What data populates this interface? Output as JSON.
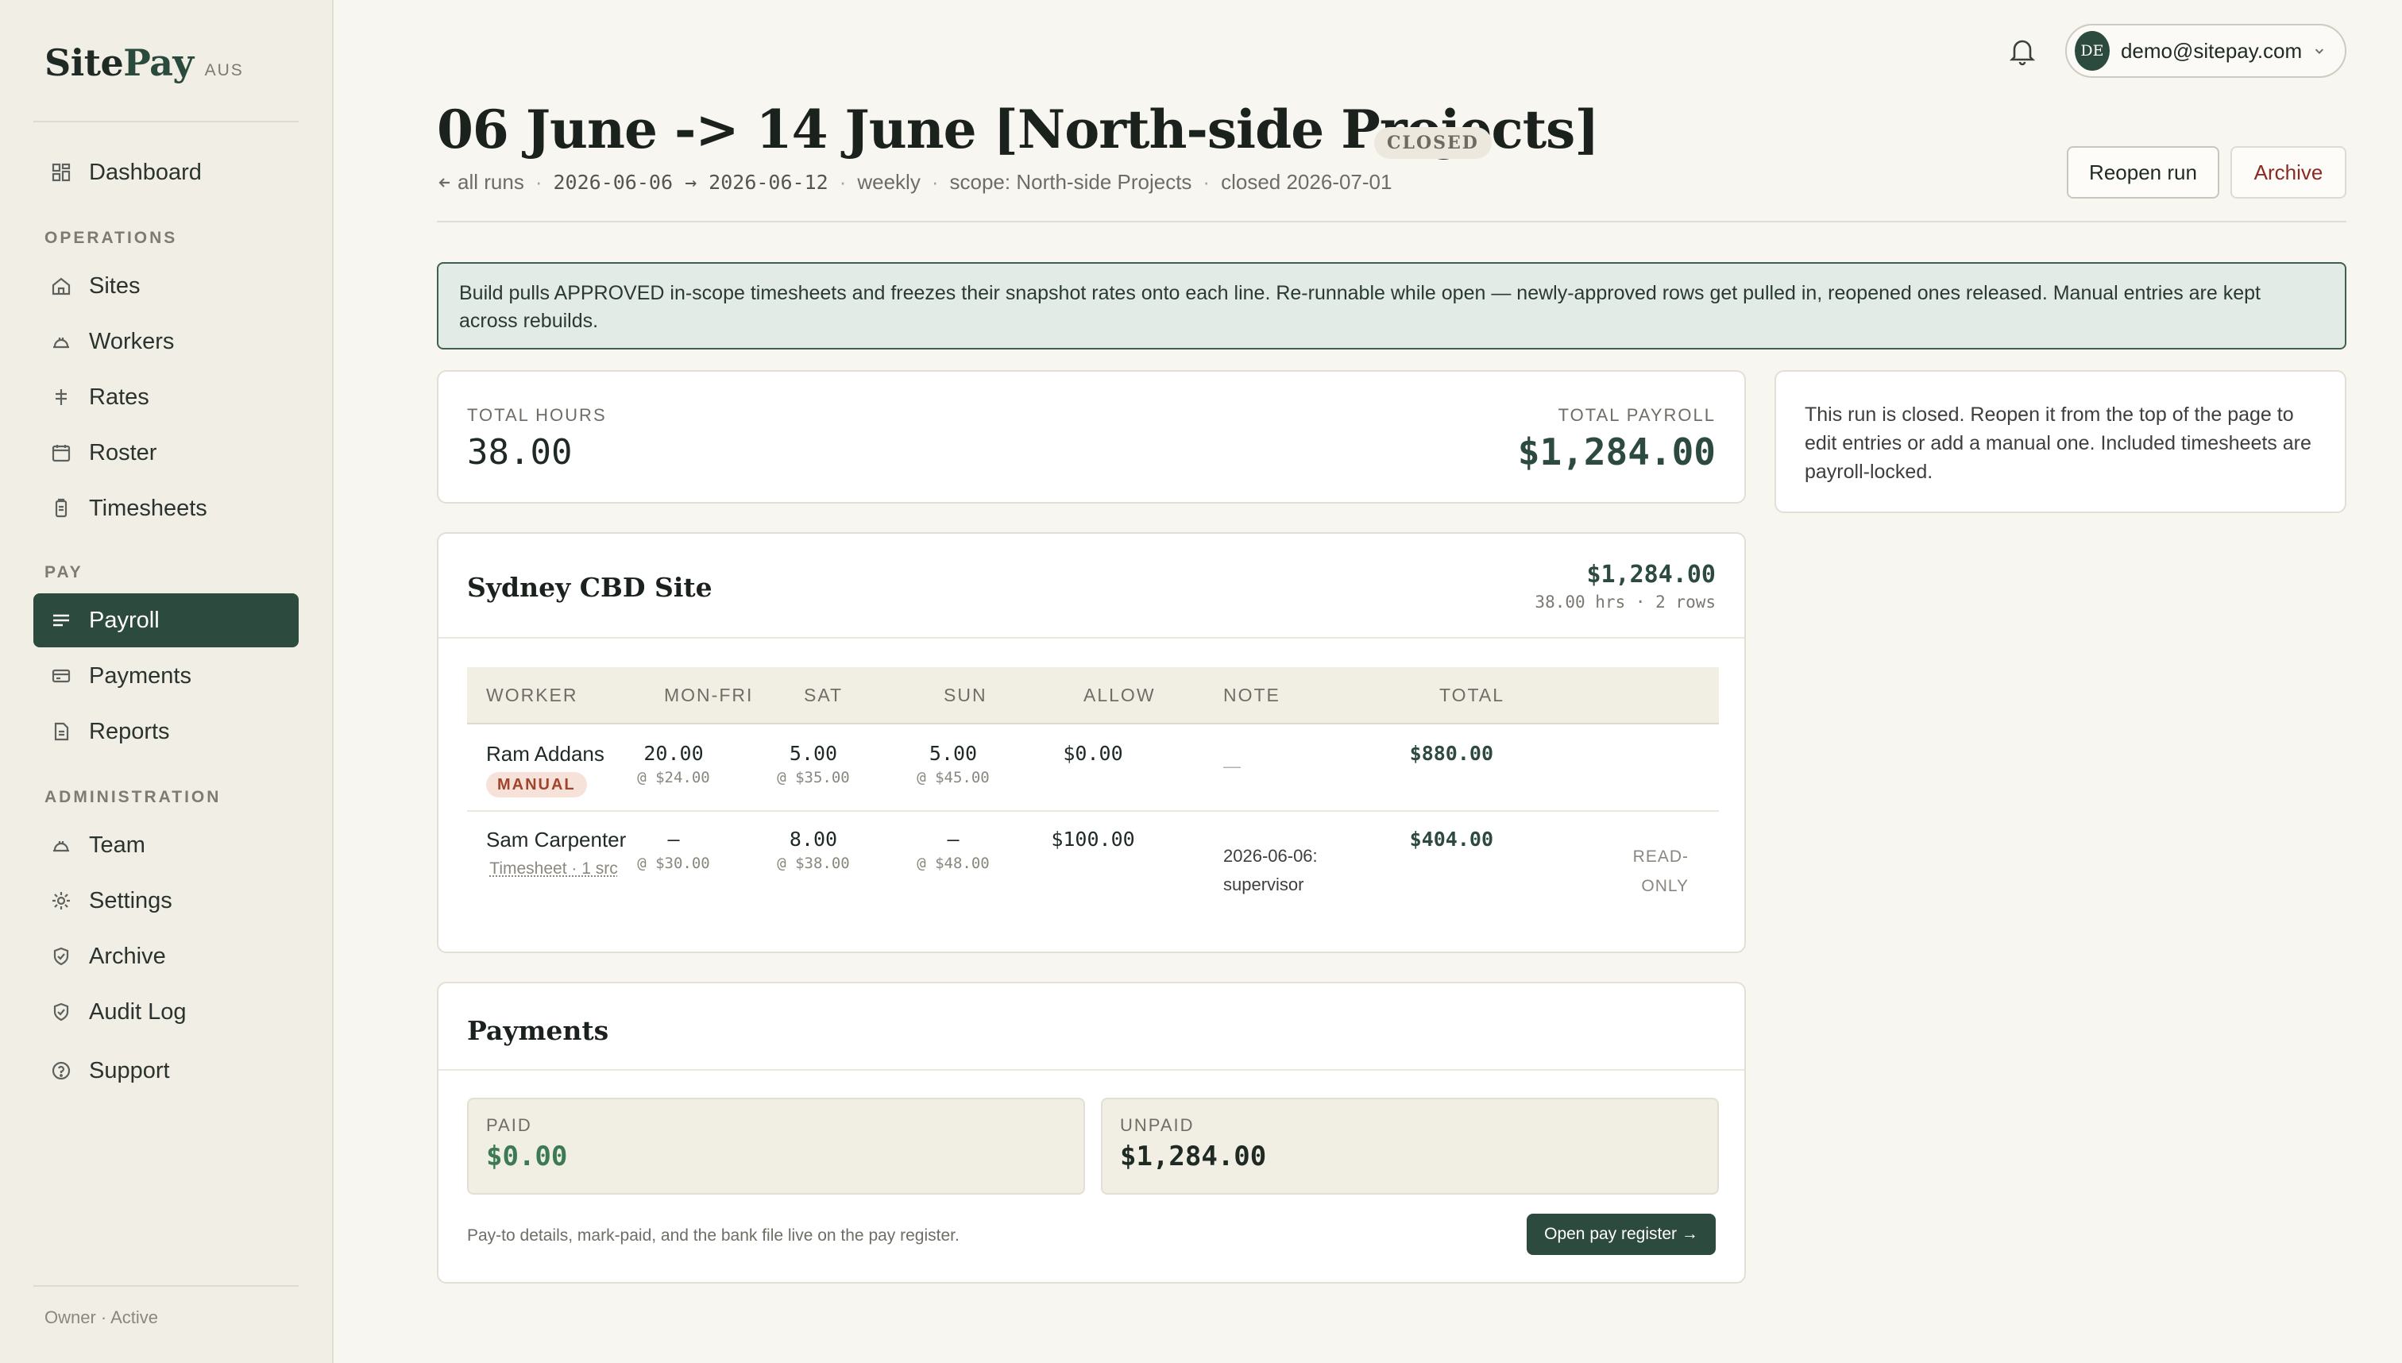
{
  "brand": {
    "name_a": "Site",
    "name_b": "Pay",
    "region": "AUS"
  },
  "sidebar": {
    "items": [
      {
        "label": "Dashboard",
        "icon": "dashboard-icon"
      },
      {
        "label": "Sites",
        "icon": "home-icon"
      },
      {
        "label": "Workers",
        "icon": "hard-hat-icon"
      },
      {
        "label": "Rates",
        "icon": "dollar-icon"
      },
      {
        "label": "Roster",
        "icon": "calendar-icon"
      },
      {
        "label": "Timesheets",
        "icon": "clipboard-icon"
      },
      {
        "label": "Payroll",
        "icon": "payroll-icon",
        "active": true
      },
      {
        "label": "Payments",
        "icon": "card-icon"
      },
      {
        "label": "Reports",
        "icon": "report-icon"
      },
      {
        "label": "Team",
        "icon": "hard-hat-icon"
      },
      {
        "label": "Settings",
        "icon": "gear-icon"
      },
      {
        "label": "Archive",
        "icon": "shield-icon"
      },
      {
        "label": "Audit Log",
        "icon": "shield-icon"
      },
      {
        "label": "Support",
        "icon": "help-icon"
      }
    ],
    "sections": {
      "operations": "OPERATIONS",
      "pay": "PAY",
      "administration": "ADMINISTRATION"
    },
    "footer": "Owner · Active"
  },
  "account": {
    "initials": "DE",
    "email": "demo@sitepay.com"
  },
  "header": {
    "title": "06 June -> 14 June [North-side Projects]",
    "status": "CLOSED",
    "back_link": "all runs",
    "dates": "2026-06-06 → 2026-06-12",
    "frequency": "weekly",
    "scope": "scope: North-side Projects",
    "closed": "closed 2026-07-01",
    "reopen_label": "Reopen run",
    "archive_label": "Archive"
  },
  "banner": "Build pulls APPROVED in-scope timesheets and freezes their snapshot rates onto each line. Re-runnable while open — newly-approved rows get pulled in, reopened ones released. Manual entries are kept across rebuilds.",
  "totals": {
    "hours_label": "TOTAL HOURS",
    "hours": "38.00",
    "payroll_label": "TOTAL PAYROLL",
    "payroll": "$1,284.00"
  },
  "side_note": "This run is closed. Reopen it from the top of the page to edit entries or add a manual one. Included timesheets are payroll-locked.",
  "site": {
    "name": "Sydney CBD Site",
    "amount": "$1,284.00",
    "summary": "38.00 hrs · 2 rows",
    "columns": [
      "WORKER",
      "MON-FRI",
      "SAT",
      "SUN",
      "ALLOW",
      "NOTE",
      "TOTAL"
    ],
    "rows": [
      {
        "worker": "Ram Addans",
        "tag": "MANUAL",
        "monfri": "20.00",
        "monfri_rate": "@ $24.00",
        "sat": "5.00",
        "sat_rate": "@ $35.00",
        "sun": "5.00",
        "sun_rate": "@ $45.00",
        "allow": "$0.00",
        "note": "—",
        "total": "$880.00"
      },
      {
        "worker": "Sam Carpenter",
        "source": "Timesheet · 1 src",
        "monfri": "—",
        "monfri_rate": "@ $30.00",
        "sat": "8.00",
        "sat_rate": "@ $38.00",
        "sun": "—",
        "sun_rate": "@ $48.00",
        "allow": "$100.00",
        "note": "2026-06-06: supervisor",
        "total": "$404.00",
        "status": "READ-ONLY"
      }
    ]
  },
  "payments": {
    "title": "Payments",
    "paid_label": "PAID",
    "paid": "$0.00",
    "unpaid_label": "UNPAID",
    "unpaid": "$1,284.00",
    "footer": "Pay-to details, mark-paid, and the bank file live on the pay register.",
    "register_button": "Open pay register →"
  }
}
